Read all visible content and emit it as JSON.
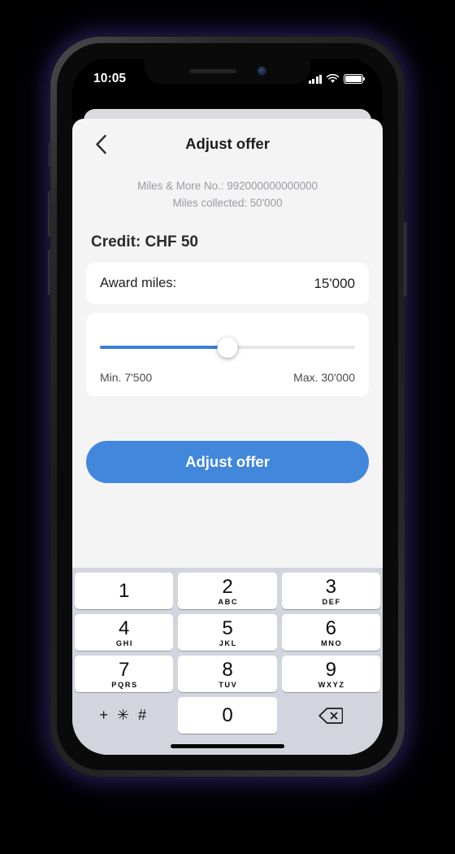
{
  "status_bar": {
    "time": "10:05",
    "signal_icon": "cellular-signal-icon",
    "wifi_icon": "wifi-icon",
    "battery_icon": "battery-full-icon"
  },
  "nav": {
    "back_icon": "chevron-left-icon",
    "title": "Adjust offer"
  },
  "account": {
    "membership_line": "Miles & More No.: 992000000000000",
    "miles_line": "Miles collected: 50'000"
  },
  "credit": {
    "heading": "Credit: CHF 50"
  },
  "award": {
    "label": "Award miles:",
    "value": "15'000"
  },
  "slider": {
    "min_label": "Min. 7'500",
    "max_label": "Max. 30'000",
    "min_value": 7500,
    "max_value": 30000,
    "current_value": 15000,
    "fill_percent": "50%",
    "thumb_percent": "50%",
    "fill_color": "#3c7fd4",
    "track_color": "#e6e6ea"
  },
  "primary_action": {
    "label": "Adjust offer",
    "color": "#4187dc"
  },
  "keyboard": {
    "rows": [
      [
        {
          "digit": "1",
          "letters": "",
          "name": "key-1"
        },
        {
          "digit": "2",
          "letters": "ABC",
          "name": "key-2"
        },
        {
          "digit": "3",
          "letters": "DEF",
          "name": "key-3"
        }
      ],
      [
        {
          "digit": "4",
          "letters": "GHI",
          "name": "key-4"
        },
        {
          "digit": "5",
          "letters": "JKL",
          "name": "key-5"
        },
        {
          "digit": "6",
          "letters": "MNO",
          "name": "key-6"
        }
      ],
      [
        {
          "digit": "7",
          "letters": "PQRS",
          "name": "key-7"
        },
        {
          "digit": "8",
          "letters": "TUV",
          "name": "key-8"
        },
        {
          "digit": "9",
          "letters": "WXYZ",
          "name": "key-9"
        }
      ]
    ],
    "symbols_key": "+ ✳ #",
    "zero_key": "0",
    "delete_icon": "backspace-delete-icon"
  },
  "colors": {
    "page_background": "#f4f4f5",
    "card_background": "#ffffff",
    "keyboard_background": "#d2d5dd",
    "accent": "#4187dc",
    "muted_text": "#9a9aa0"
  }
}
